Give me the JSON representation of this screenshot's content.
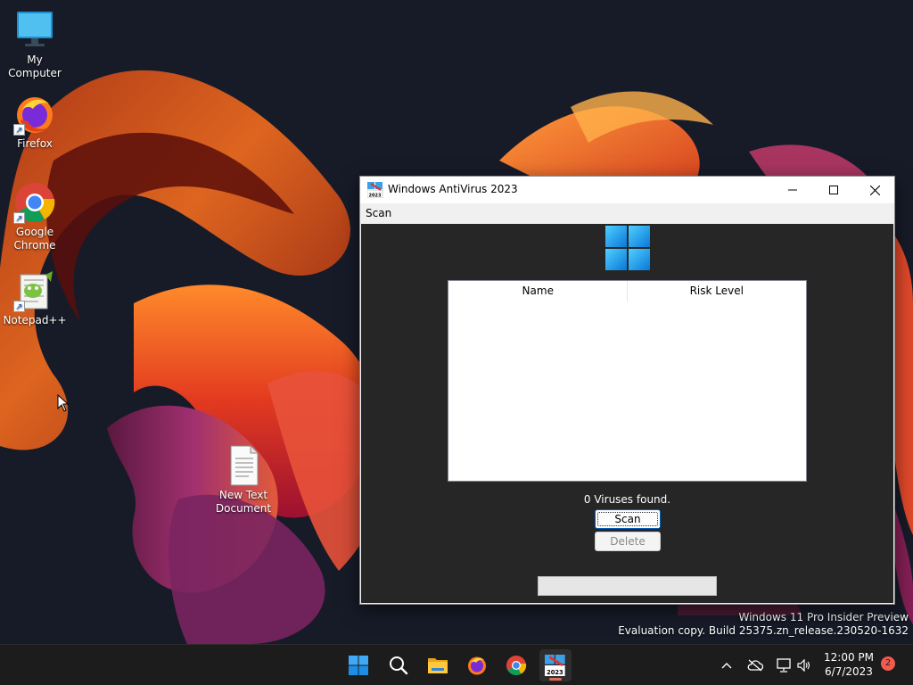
{
  "desktop": {
    "icons": [
      {
        "label": "My Computer"
      },
      {
        "label": "Firefox"
      },
      {
        "label": "Google Chrome"
      },
      {
        "label": "Notepad++"
      },
      {
        "label": "New Text Document"
      }
    ],
    "watermark": {
      "line1": "Windows 11 Pro Insider Preview",
      "line2": "Evaluation copy. Build 25375.zn_release.230520-1632"
    }
  },
  "window": {
    "title": "Windows AntiVirus 2023",
    "menu": {
      "scan_label": "Scan"
    },
    "table": {
      "columns": [
        "Name",
        "Risk Level"
      ],
      "rows": []
    },
    "status_text": "0 Viruses found.",
    "scan_button_label": "Scan",
    "delete_button_label": "Delete",
    "progress_fraction": 0
  },
  "taskbar": {
    "pinned": [
      "start-icon",
      "search-icon",
      "file-explorer-icon",
      "firefox-icon",
      "chrome-icon",
      "antivirus-app-icon"
    ],
    "clock_time": "12:00 PM",
    "clock_date": "6/7/2023",
    "notification_count": "2"
  },
  "colors": {
    "window_client_bg": "#262626",
    "taskbar_bg": "#1c1c1c",
    "windows_blue": "#0078d4",
    "notification_badge": "#f05b4f"
  }
}
